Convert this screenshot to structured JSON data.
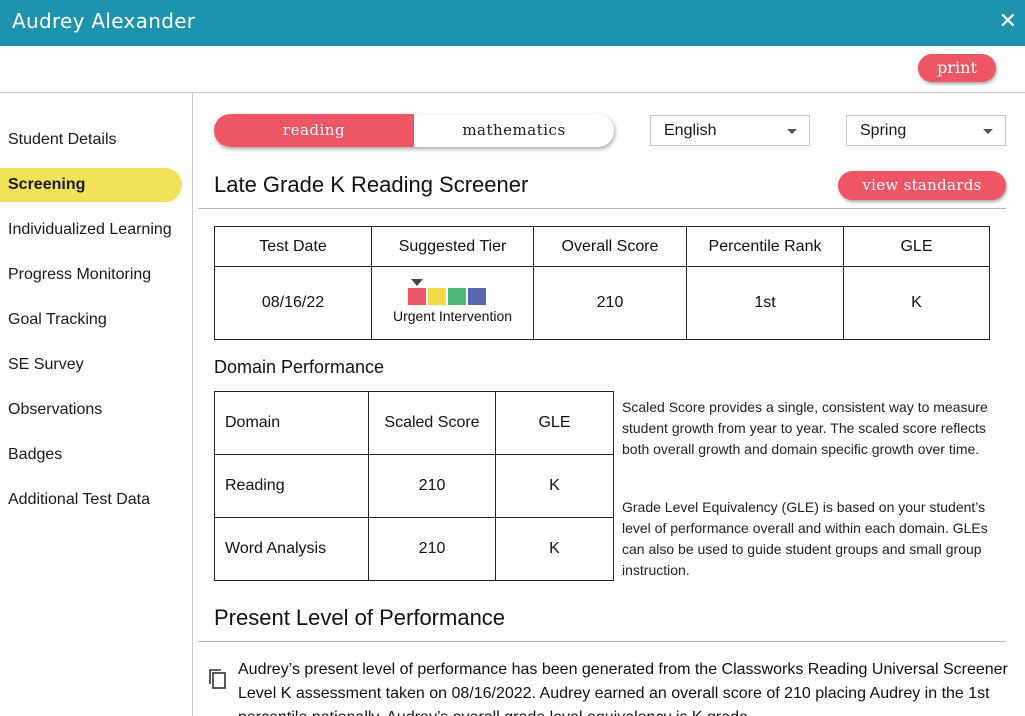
{
  "window": {
    "title": "Audrey Alexander",
    "close_icon": "✕"
  },
  "toolbar": {
    "print_label": "print"
  },
  "sidebar": {
    "items": [
      {
        "label": "Student Details",
        "active": false
      },
      {
        "label": "Screening",
        "active": true
      },
      {
        "label": "Individualized Learning",
        "active": false
      },
      {
        "label": "Progress Monitoring",
        "active": false
      },
      {
        "label": "Goal Tracking",
        "active": false
      },
      {
        "label": "SE Survey",
        "active": false
      },
      {
        "label": "Observations",
        "active": false
      },
      {
        "label": "Badges",
        "active": false
      },
      {
        "label": "Additional Test Data",
        "active": false
      }
    ]
  },
  "subject_toggle": {
    "options": [
      "reading",
      "mathematics"
    ],
    "selected": "reading"
  },
  "language_select": {
    "value": "English"
  },
  "season_select": {
    "value": "Spring"
  },
  "screener": {
    "title": "Late Grade K Reading Screener",
    "view_standards_label": "view standards",
    "headers": [
      "Test Date",
      "Suggested Tier",
      "Overall Score",
      "Percentile Rank",
      "GLE"
    ],
    "row": {
      "test_date": "08/16/22",
      "tier_label": "Urgent Intervention",
      "tier_colors": [
        "#ee5565",
        "#f2d94a",
        "#4fb87a",
        "#5b66b3"
      ],
      "tier_selected_index": 0,
      "overall_score": "210",
      "percentile_rank": "1st",
      "gle": "K"
    }
  },
  "domain_performance": {
    "title": "Domain Performance",
    "headers": [
      "Domain",
      "Scaled Score",
      "GLE"
    ],
    "rows": [
      {
        "domain": "Reading",
        "scaled_score": "210",
        "gle": "K"
      },
      {
        "domain": "Word Analysis",
        "scaled_score": "210",
        "gle": "K"
      }
    ],
    "note_scaled": "Scaled Score provides a single, consistent way to measure student growth from year to year. The scaled score reflects both overall growth and domain specific growth over time.",
    "note_gle": "Grade Level Equivalency (GLE) is based on your student’s level of performance overall and within each domain. GLEs can also be used to guide student groups and small group instruction."
  },
  "present_level": {
    "title": "Present Level of Performance",
    "text": "Audrey’s present level of performance has been generated from the Classworks Reading Universal Screener Level K assessment taken on 08/16/2022. Audrey earned an overall score of 210 placing Audrey in the 1st percentile nationally. Audrey’s overall grade level equivalency is K grade."
  }
}
